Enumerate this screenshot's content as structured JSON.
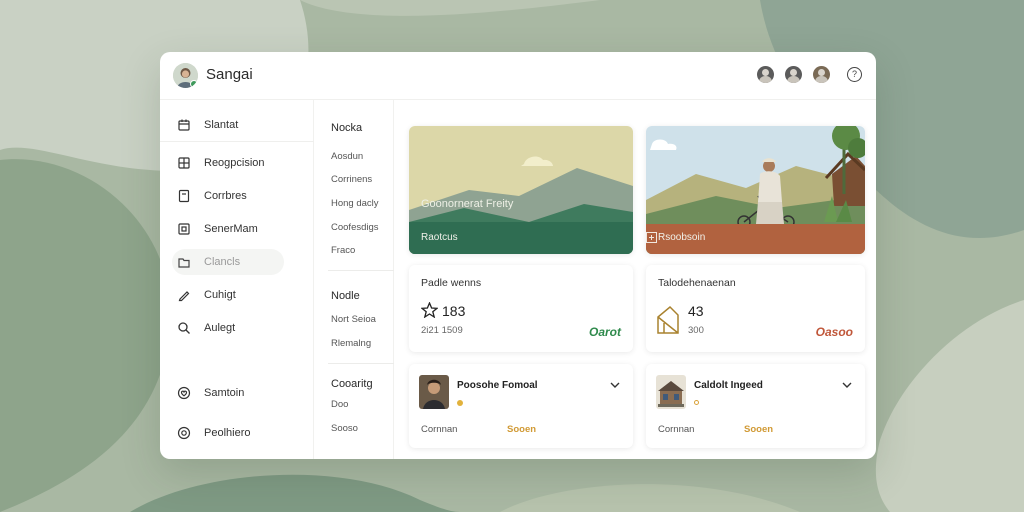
{
  "app": {
    "title": "Sangai"
  },
  "sidebar": {
    "items": [
      {
        "label": "Slantat",
        "icon": "calendar-icon"
      },
      {
        "label": "Reogpcision",
        "icon": "grid-icon"
      },
      {
        "label": "Corrbres",
        "icon": "document-icon"
      },
      {
        "label": "SenerMam",
        "icon": "square-icon"
      },
      {
        "label": "Clancls",
        "icon": "folder-icon"
      },
      {
        "label": "Cuhigt",
        "icon": "pen-icon"
      },
      {
        "label": "Aulegt",
        "icon": "search-icon"
      },
      {
        "label": "Samtoin",
        "icon": "heart-icon"
      },
      {
        "label": "Peolhiero",
        "icon": "globe-icon"
      }
    ]
  },
  "submenu": {
    "sections": [
      {
        "heading": "Nocka",
        "items": [
          "Aosdun",
          "Corrinens",
          "Hong dacly",
          "Coofesdigs",
          "Fraco"
        ]
      },
      {
        "heading": "Nodle",
        "items": [
          "Nort Seioa",
          "Rlemalng"
        ]
      },
      {
        "heading": "Cooaritg",
        "items": [
          "Doo",
          "Sooso"
        ]
      }
    ]
  },
  "hero_cards": [
    {
      "title": "Goonornerat Freity",
      "caption": "Raotcus"
    },
    {
      "caption": "Rsoobsoin"
    }
  ],
  "stat_cards": [
    {
      "title": "Padle wenns",
      "value": "183",
      "sub": "2i21 1509",
      "tag": "Oarot",
      "tag_color": "#2f8a4c"
    },
    {
      "title": "Talodehenaenan",
      "value": "43",
      "sub": "300",
      "tag": "Oasoo",
      "tag_color": "#c0573a"
    }
  ],
  "item_cards": [
    {
      "name": "Poosohe Fomoal",
      "footer": "Cornnan",
      "amount": "Sooen"
    },
    {
      "name": "Caldolt Ingeed",
      "footer": "Cornnan",
      "amount": "Sooen"
    }
  ],
  "colors": {
    "accent_green": "#2f8a4c",
    "accent_rust": "#c0573a",
    "accent_gold": "#d19a35"
  }
}
